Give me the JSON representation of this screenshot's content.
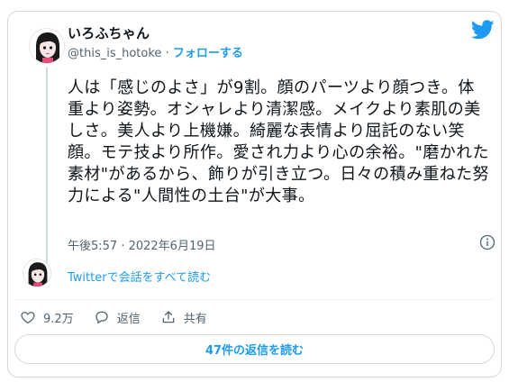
{
  "author": {
    "display_name": "いろふちゃん",
    "handle": "@this_is_hotoke",
    "separator": "·",
    "follow_label": "フォローする"
  },
  "tweet": {
    "text": "人は「感じのよさ」が9割。顔のパーツより顔つき。体重より姿勢。オシャレより清潔感。メイクより素肌の美しさ。美人より上機嫌。綺麗な表情より屈託のない笑顔。モテ技より所作。愛され力より心の余裕。\"磨かれた素材\"があるから、飾りが引き立つ。日々の積み重ねた努力による\"人間性の土台\"が大事。",
    "timestamp": "午後5:57 · 2022年6月19日"
  },
  "conversation": {
    "link_label": "Twitterで会話をすべて読む"
  },
  "actions": {
    "like_count": "9.2万",
    "reply_label": "返信",
    "share_label": "共有"
  },
  "replies_button": {
    "label": "47件の返信を読む"
  },
  "colors": {
    "accent": "#1d9bf0",
    "text": "#0f1419",
    "muted": "#536471",
    "border": "#cfd9de"
  },
  "icons": [
    "twitter-bird-icon",
    "info-icon",
    "heart-icon",
    "reply-icon",
    "share-icon"
  ]
}
